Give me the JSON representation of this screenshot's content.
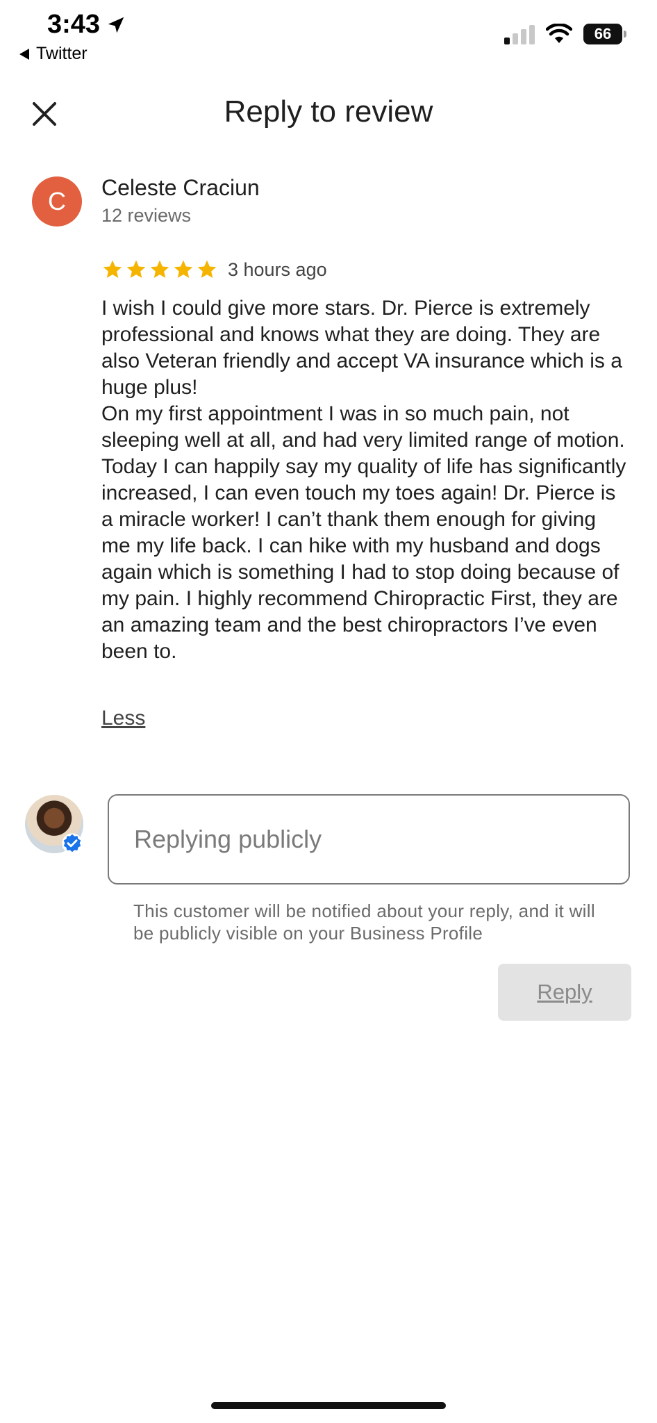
{
  "status_bar": {
    "time": "3:43",
    "back_app": "Twitter",
    "battery": "66"
  },
  "header": {
    "title": "Reply to review"
  },
  "review": {
    "avatar_letter": "C",
    "avatar_color": "#e2603f",
    "reviewer_name": "Celeste Craciun",
    "reviewer_count": "12 reviews",
    "rating": 5,
    "time_ago": "3 hours ago",
    "text": "I wish I could give more stars. Dr. Pierce is extremely professional and knows what they are doing. They are also Veteran friendly and accept VA insurance which is a huge plus!\nOn my first appointment I was in so much pain, not sleeping well at all, and had very limited range of motion. Today I can happily say my quality of life has significantly increased, I can even touch my toes again! Dr. Pierce is a miracle worker! I can’t thank them enough for giving me my life back. I can hike with my husband and dogs again which is something I had to stop doing because of my pain. I highly recommend Chiropractic First, they are an amazing team and the best chiropractors I’ve even been to.",
    "less_label": "Less"
  },
  "reply": {
    "placeholder": "Replying publicly",
    "value": "",
    "notice": "This customer will be notified about your reply, and it will be publicly visible on your Business Profile",
    "button_label": "Reply"
  },
  "colors": {
    "star": "#f4b400",
    "verified": "#1a73e8",
    "button_bg": "#e3e3e3"
  }
}
